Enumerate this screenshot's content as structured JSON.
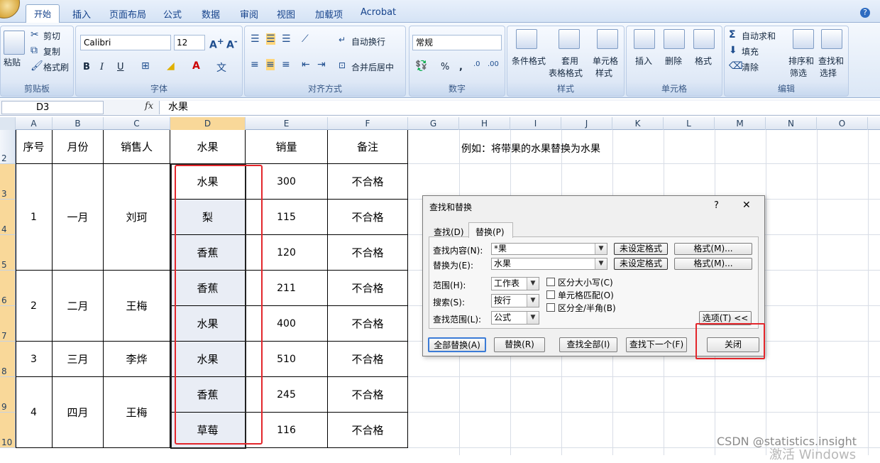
{
  "ribbon": {
    "tabs": [
      "开始",
      "插入",
      "页面布局",
      "公式",
      "数据",
      "审阅",
      "视图",
      "加载项",
      "Acrobat"
    ],
    "help": "?",
    "clipboard": {
      "paste": "粘贴",
      "cut": "剪切",
      "copy": "复制",
      "format_painter": "格式刷",
      "label": "剪贴板"
    },
    "font": {
      "name": "Calibri",
      "size": "12",
      "label": "字体",
      "bold": "B",
      "italic": "I",
      "underline": "U"
    },
    "alignment": {
      "wrap": "自动换行",
      "merge": "合并后居中",
      "label": "对齐方式"
    },
    "number": {
      "format": "常规",
      "label": "数字",
      "percent": "%",
      "comma": ","
    },
    "styles": {
      "conditional": "条件格式",
      "table_format_1": "套用",
      "table_format_2": "表格格式",
      "cell_styles_1": "单元格",
      "cell_styles_2": "样式",
      "label": "样式"
    },
    "cells": {
      "insert": "插入",
      "delete": "删除",
      "format": "格式",
      "label": "单元格"
    },
    "editing": {
      "autosum": "自动求和",
      "fill": "填充",
      "clear": "清除",
      "sort_1": "排序和",
      "sort_2": "筛选",
      "find_1": "查找和",
      "find_2": "选择",
      "label": "编辑"
    }
  },
  "formula_bar": {
    "name_box": "D3",
    "fx": "fx",
    "content": "水果"
  },
  "sheet": {
    "columns": [
      "A",
      "B",
      "C",
      "D",
      "E",
      "F",
      "G",
      "H",
      "I",
      "J",
      "K",
      "L",
      "M",
      "N",
      "O"
    ],
    "rows": [
      "2",
      "3",
      "4",
      "5",
      "6",
      "7",
      "8",
      "9",
      "10"
    ],
    "headers": [
      "序号",
      "月份",
      "销售人",
      "水果",
      "销量",
      "备注"
    ],
    "note": "例如：将带果的水果替换为水果",
    "groups": [
      {
        "seq": "1",
        "month": "一月",
        "seller": "刘珂"
      },
      {
        "seq": "2",
        "month": "二月",
        "seller": "王梅"
      },
      {
        "seq": "3",
        "month": "三月",
        "seller": "李烨"
      },
      {
        "seq": "4",
        "month": "四月",
        "seller": "王梅"
      }
    ],
    "fruits": [
      "水果",
      "梨",
      "香蕉",
      "香蕉",
      "水果",
      "水果",
      "香蕉",
      "草莓"
    ],
    "sales": [
      "300",
      "115",
      "120",
      "211",
      "400",
      "510",
      "245",
      "116"
    ],
    "remarks": [
      "不合格",
      "不合格",
      "不合格",
      "不合格",
      "不合格",
      "不合格",
      "不合格",
      "不合格"
    ]
  },
  "dialog": {
    "title": "查找和替换",
    "help": "?",
    "close_x": "✕",
    "tab_find": "查找(D)",
    "tab_replace": "替换(P)",
    "find_label": "查找内容(N):",
    "find_value": "*果",
    "replace_label": "替换为(E):",
    "replace_value": "水果",
    "no_format": "未设定格式",
    "format_btn": "格式(M)...",
    "scope_label": "范围(H):",
    "scope_value": "工作表",
    "search_label": "搜索(S):",
    "search_value": "按行",
    "lookin_label": "查找范围(L):",
    "lookin_value": "公式",
    "match_case": "区分大小写(C)",
    "match_cell": "单元格匹配(O)",
    "match_width": "区分全/半角(B)",
    "options_btn": "选项(T) <<",
    "replace_all": "全部替换(A)",
    "replace": "替换(R)",
    "find_all": "查找全部(I)",
    "find_next": "查找下一个(F)",
    "close": "关闭"
  },
  "watermark": {
    "csdn": "CSDN @statistics.insight",
    "windows": "激活 Windows"
  },
  "colors": {
    "highlight": "#e3262b",
    "selected_fill": "#e9edf5",
    "ribbon": "#dbe7f6"
  }
}
